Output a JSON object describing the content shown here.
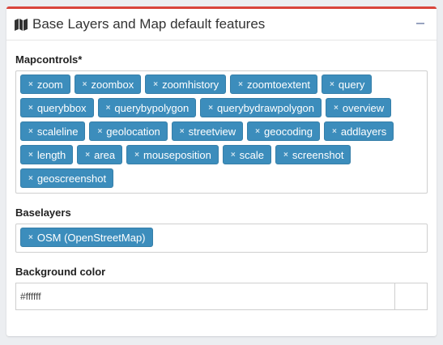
{
  "panel": {
    "title": "Base Layers and Map default features",
    "title_icon": "map-icon",
    "collapse_icon": "minus-icon"
  },
  "mapcontrols": {
    "label": "Mapcontrols*",
    "tags": [
      "zoom",
      "zoombox",
      "zoomhistory",
      "zoomtoextent",
      "query",
      "querybbox",
      "querybypolygon",
      "querybydrawpolygon",
      "overview",
      "scaleline",
      "geolocation",
      "streetview",
      "geocoding",
      "addlayers",
      "length",
      "area",
      "mouseposition",
      "scale",
      "screenshot",
      "geoscreenshot"
    ]
  },
  "baselayers": {
    "label": "Baselayers",
    "tags": [
      "OSM (OpenStreetMap)"
    ]
  },
  "background": {
    "label": "Background color",
    "value": "#ffffff"
  },
  "colors": {
    "accent_top": "#d9453c",
    "tag_bg": "#3c8dbc"
  }
}
